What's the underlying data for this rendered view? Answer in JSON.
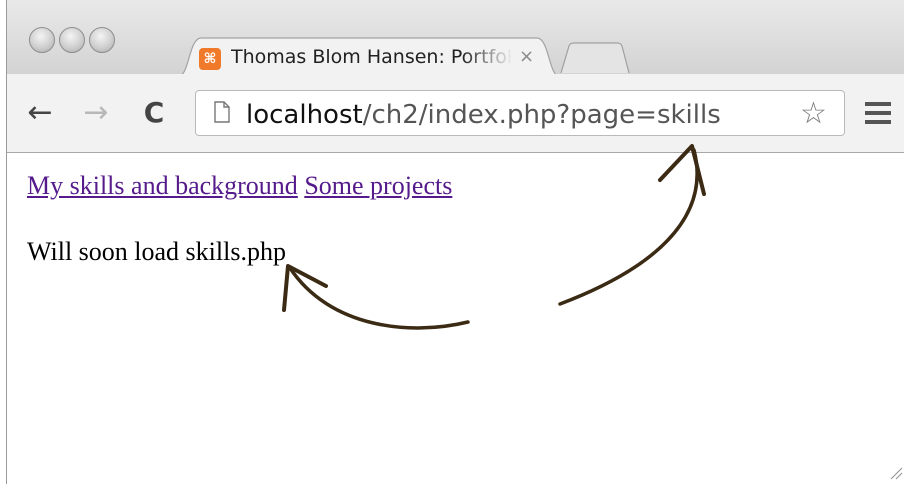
{
  "browser": {
    "tab": {
      "favicon_text": "⌘",
      "title": "Thomas Blom Hansen: Portfolio",
      "close": "×"
    },
    "address_bar": {
      "host": "localhost",
      "path": "/ch2/index.php?page=skills"
    },
    "icons": {
      "back": "←",
      "forward": "→",
      "reload": "C",
      "bookmark": "☆"
    }
  },
  "page": {
    "nav": [
      {
        "label": "My skills and background"
      },
      {
        "label": "Some projects"
      }
    ],
    "message": "Will soon load skills.php"
  },
  "colors": {
    "link": "#551a8b",
    "favicon": "#f07a2a",
    "annotation_arrow": "#3b2a14"
  }
}
